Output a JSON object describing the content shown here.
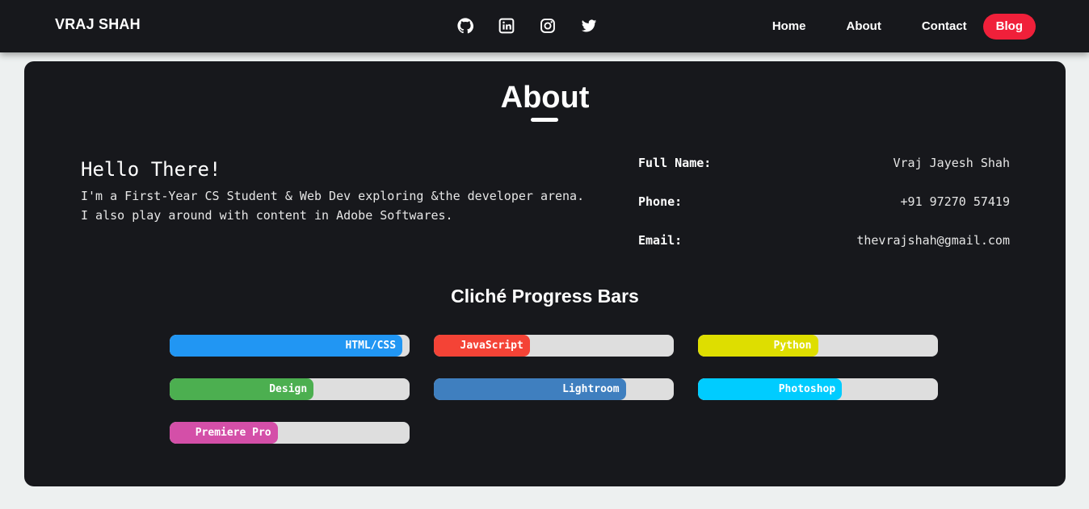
{
  "header": {
    "brand": "VRAJ SHAH",
    "social_icons": [
      "github-icon",
      "linkedin-icon",
      "instagram-icon",
      "twitter-icon"
    ],
    "nav": {
      "home": "Home",
      "about": "About",
      "contact": "Contact",
      "blog": "Blog"
    },
    "accent_color": "#f0203a"
  },
  "about": {
    "title": "About",
    "greeting": "Hello There!",
    "bio": "I'm a First-Year CS Student & Web Dev exploring &the developer arena. I also play around with content in Adobe Softwares.",
    "info": [
      {
        "label": "Full Name:",
        "value": "Vraj Jayesh Shah"
      },
      {
        "label": "Phone:",
        "value": "+91 97270 57419"
      },
      {
        "label": "Email:",
        "value": "thevrajshah@gmail.com"
      }
    ]
  },
  "progress": {
    "title": "Cliché Progress Bars",
    "bars": [
      {
        "label": "HTML/CSS",
        "percent": 97,
        "color": "#2196f3"
      },
      {
        "label": "JavaScript",
        "percent": 40,
        "color": "#f44336"
      },
      {
        "label": "Python",
        "percent": 50,
        "color": "#dede00"
      },
      {
        "label": "Design",
        "percent": 60,
        "color": "#4caf50"
      },
      {
        "label": "Lightroom",
        "percent": 80,
        "color": "#3f7fbf"
      },
      {
        "label": "Photoshop",
        "percent": 60,
        "color": "#00ccff"
      },
      {
        "label": "Premiere Pro",
        "percent": 45,
        "color": "#d44fa8"
      }
    ]
  }
}
